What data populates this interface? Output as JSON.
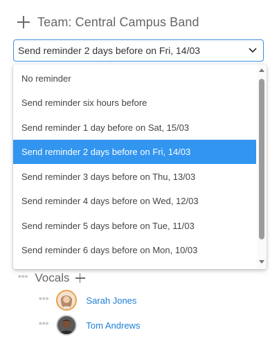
{
  "team": {
    "title": "Team: Central Campus Band",
    "add_icon": "plus-icon"
  },
  "reminder_select": {
    "value": "Send reminder 2 days before on Fri, 14/03",
    "icon": "chevron-down-icon",
    "border_color": "#3d8ee0"
  },
  "dropdown": {
    "options": [
      {
        "label": "No reminder",
        "selected": false
      },
      {
        "label": "Send reminder six hours before",
        "selected": false
      },
      {
        "label": "Send reminder 1 day before on Sat, 15/03",
        "selected": false
      },
      {
        "label": "Send reminder 2 days before on Fri, 14/03",
        "selected": true
      },
      {
        "label": "Send reminder 3 days before on Thu, 13/03",
        "selected": false
      },
      {
        "label": "Send reminder 4 days before on Wed, 12/03",
        "selected": false
      },
      {
        "label": "Send reminder 5 days before on Tue, 11/03",
        "selected": false
      },
      {
        "label": "Send reminder 6 days before on Mon, 10/03",
        "selected": false
      }
    ],
    "selected_color": "#3295f0"
  },
  "section": {
    "drag_icon": "dots-icon",
    "label": "Vocals",
    "add_icon": "plus-icon"
  },
  "members": [
    {
      "name": "Sarah Jones",
      "avatar": "avatar"
    },
    {
      "name": "Tom Andrews",
      "avatar": "avatar"
    }
  ],
  "colors": {
    "link": "#1a7fd6",
    "avatar_ring_1": "#e8a24a"
  }
}
